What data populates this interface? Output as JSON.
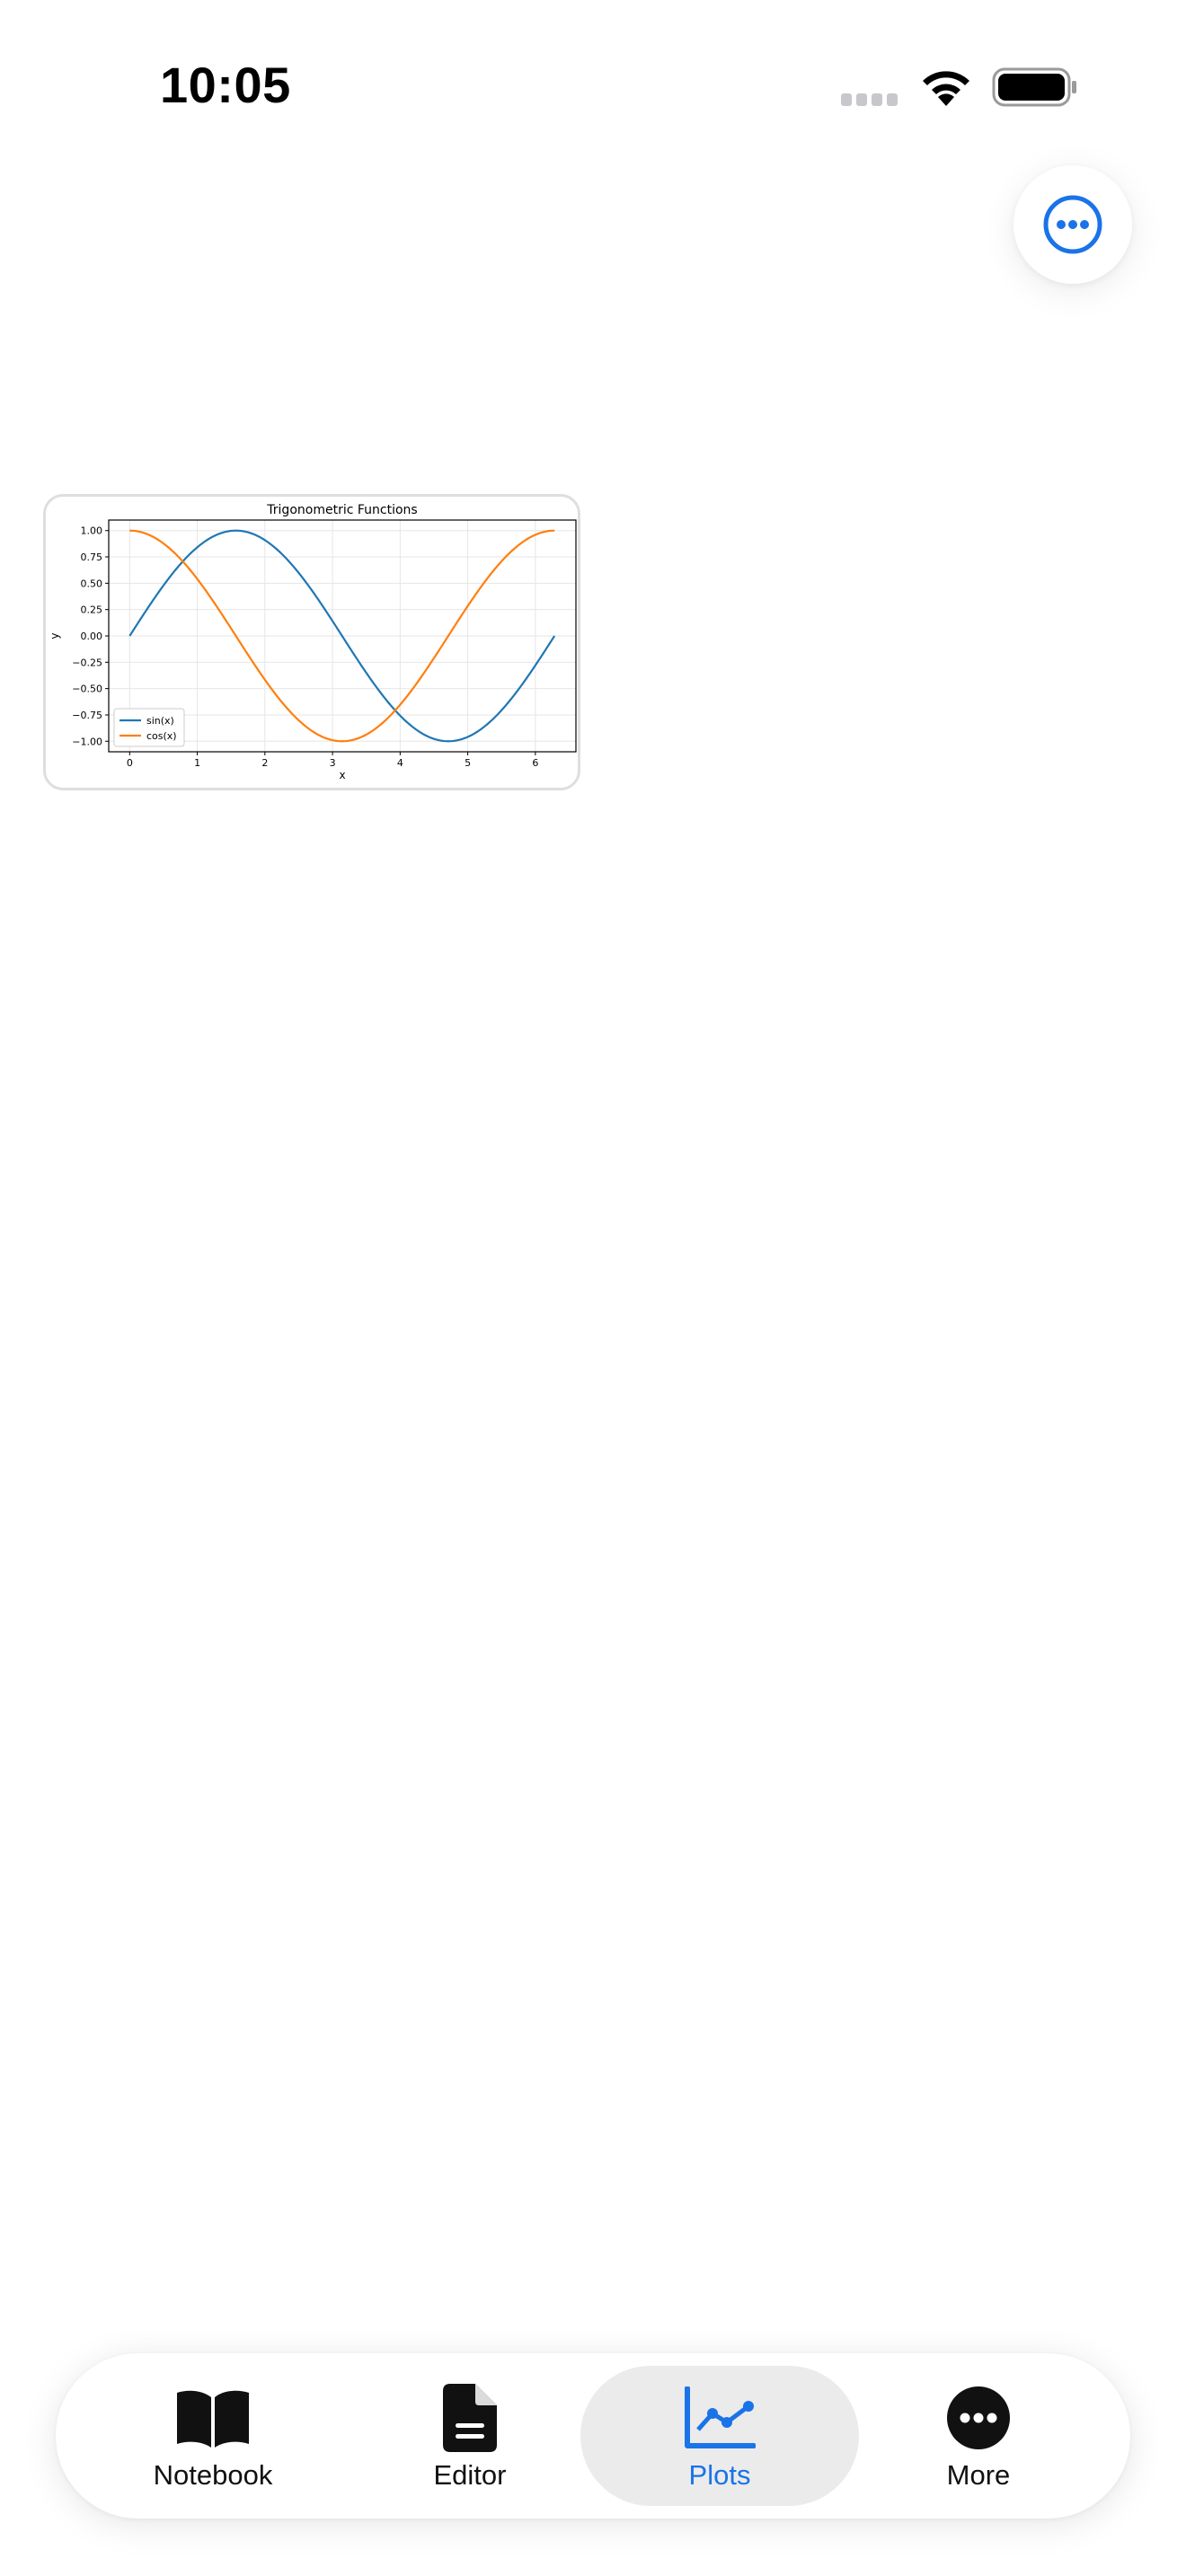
{
  "status_bar": {
    "time": "10:05"
  },
  "plot": {
    "chart_data": {
      "type": "line",
      "title": "Trigonometric Functions",
      "xlabel": "x",
      "ylabel": "y",
      "xlim": [
        -0.31,
        6.6
      ],
      "ylim": [
        -1.1,
        1.1
      ],
      "xticks": [
        "0",
        "1",
        "2",
        "3",
        "4",
        "5",
        "6"
      ],
      "yticks": [
        "1.00",
        "0.75",
        "0.50",
        "0.25",
        "0.00",
        "−0.25",
        "−0.50",
        "−0.75",
        "−1.00"
      ],
      "grid": true,
      "legend_position": "lower-left",
      "series": [
        {
          "name": "sin(x)",
          "function": "sin",
          "domain": [
            0,
            6.2832
          ],
          "color": "#1f77b4"
        },
        {
          "name": "cos(x)",
          "function": "cos",
          "domain": [
            0,
            6.2832
          ],
          "color": "#ff7f0e"
        }
      ]
    }
  },
  "tab_bar": {
    "tabs": [
      {
        "label": "Notebook",
        "icon": "book-icon",
        "active": false
      },
      {
        "label": "Editor",
        "icon": "document-icon",
        "active": false
      },
      {
        "label": "Plots",
        "icon": "chart-icon",
        "active": true
      },
      {
        "label": "More",
        "icon": "ellipsis-icon",
        "active": false
      }
    ],
    "accent_color": "#1a73e8"
  }
}
